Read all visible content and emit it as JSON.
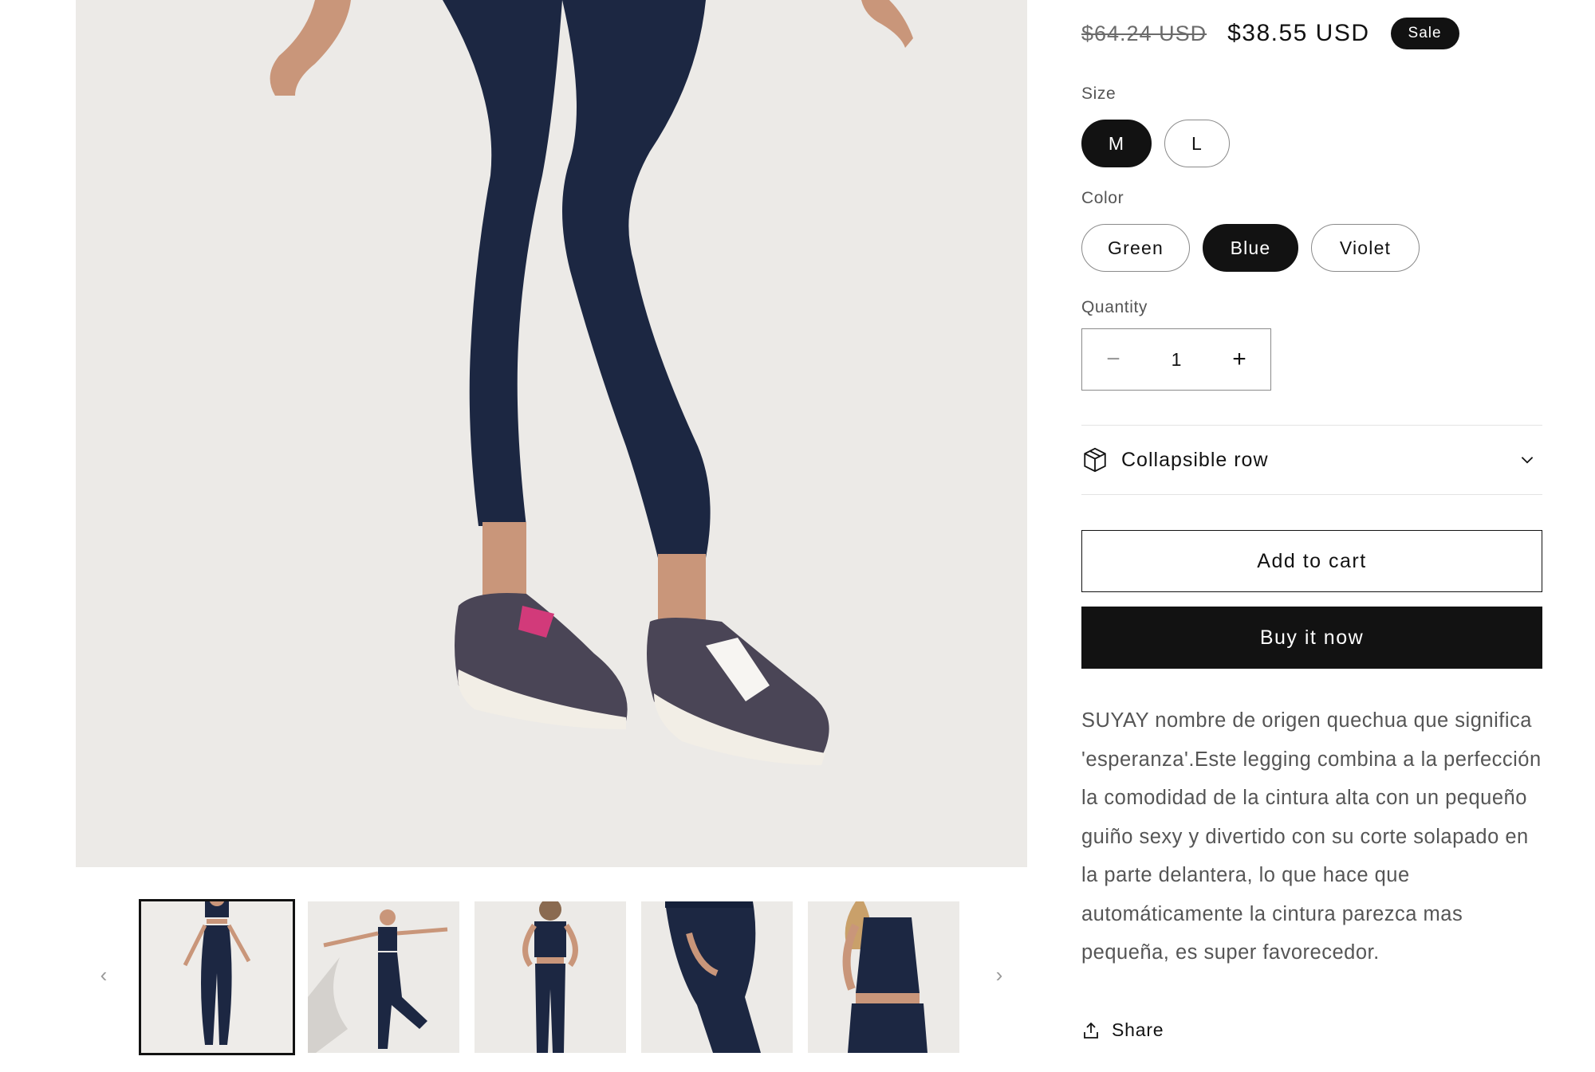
{
  "product": {
    "price_regular": "$64.24 USD",
    "price_sale": "$38.55 USD",
    "sale_badge": "Sale"
  },
  "size": {
    "label": "Size",
    "options": [
      "M",
      "L"
    ],
    "selected": "M"
  },
  "color": {
    "label": "Color",
    "options": [
      "Green",
      "Blue",
      "Violet"
    ],
    "selected": "Blue"
  },
  "quantity": {
    "label": "Quantity",
    "value": "1",
    "minus": "−",
    "plus": "+"
  },
  "collapsible": {
    "label": "Collapsible row",
    "icon": "package-box-icon"
  },
  "buttons": {
    "add_to_cart": "Add to cart",
    "buy_now": "Buy it now"
  },
  "description": "SUYAY nombre de origen quechua que significa 'esperanza'.Este legging combina a la perfección la comodidad de la cintura alta con un pequeño guiño sexy y divertido con su corte solapado en la parte delantera, lo que hace que automáticamente la cintura parezca mas pequeña, es super favorecedor.",
  "share": {
    "label": "Share",
    "icon": "share-upload-icon"
  },
  "gallery": {
    "prev": "‹",
    "next": "›",
    "thumbnail_count": 5,
    "active_index": 0
  },
  "colors": {
    "legging": "#1c2742",
    "background": "#eceae7",
    "text": "#121212",
    "muted": "#555555"
  }
}
